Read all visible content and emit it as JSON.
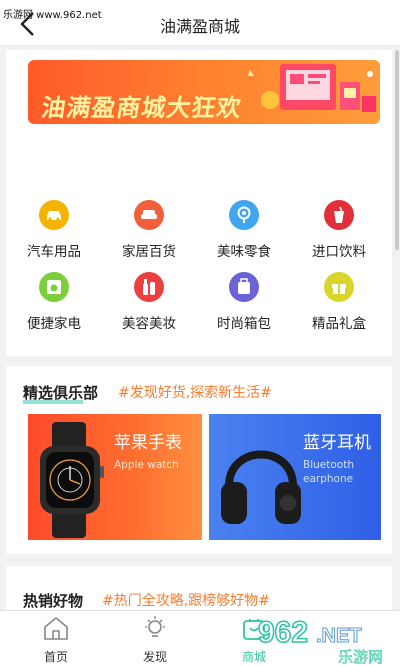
{
  "watermark": "乐游网 www.962.net",
  "header": {
    "title": "油满盈商城"
  },
  "banner": {
    "text": "油满盈商城大狂欢"
  },
  "categories": [
    {
      "label": "汽车用品",
      "icon": "car-icon",
      "color": "#f5b301"
    },
    {
      "label": "家居百货",
      "icon": "sofa-icon",
      "color": "#f0603b"
    },
    {
      "label": "美味零食",
      "icon": "lollipop-icon",
      "color": "#3fa6ef"
    },
    {
      "label": "进口饮料",
      "icon": "drink-icon",
      "color": "#e0313b"
    },
    {
      "label": "便捷家电",
      "icon": "washer-icon",
      "color": "#7ccf3b"
    },
    {
      "label": "美容美妆",
      "icon": "cosmetics-icon",
      "color": "#ec3f3f"
    },
    {
      "label": "时尚箱包",
      "icon": "luggage-icon",
      "color": "#6a62d6"
    },
    {
      "label": "精品礼盒",
      "icon": "gift-icon",
      "color": "#d9d52a"
    }
  ],
  "club": {
    "title": "精选俱乐部",
    "subtitle": "#发现好货,探索新生活#",
    "promos": [
      {
        "title": "苹果手表",
        "subtitle": "Apple watch"
      },
      {
        "title": "蓝牙耳机",
        "subtitle_line1": "Bluetooth",
        "subtitle_line2": "earphone"
      }
    ]
  },
  "hot": {
    "title": "热销好物",
    "subtitle": "#热门全攻略,跟榜够好物#"
  },
  "tabs": [
    {
      "label": "首页",
      "icon": "home-icon"
    },
    {
      "label": "发现",
      "icon": "lightbulb-icon"
    },
    {
      "label": "商城",
      "icon": "shop-icon"
    }
  ],
  "overlay_logo": {
    "main": "962",
    "suffix": ".NET",
    "cn": "乐游网"
  },
  "colors": {
    "accent": "#2cc4a0",
    "orange": "#ff7a2d"
  }
}
